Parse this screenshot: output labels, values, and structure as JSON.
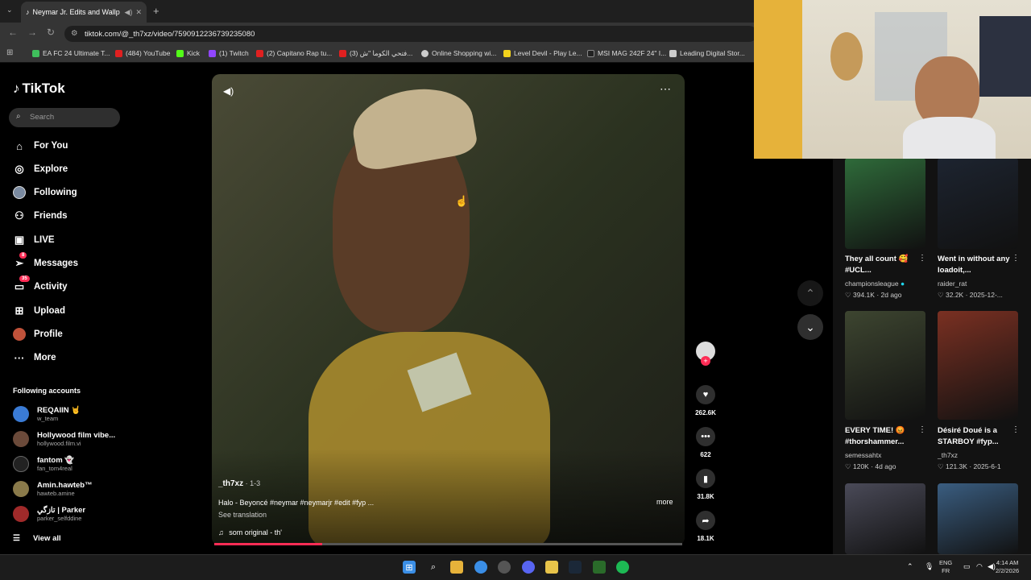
{
  "browser": {
    "tab_title": "Neymar Jr. Edits and Wallp",
    "url": "tiktok.com/@_th7xz/video/7590912236739235080",
    "bookmarks": [
      "EA FC 24 Ultimate T...",
      "(484) YouTube",
      "Kick",
      "(1) Twitch",
      "(2) Capitano Rap tu...",
      "(3) فتحي الكوما \"ش...",
      "Online Shopping wi...",
      "Level Devil - Play Le...",
      "MSI MAG 242F 24\" I...",
      "Leading Digital Stor..."
    ]
  },
  "sidebar": {
    "logo": "TikTok",
    "search_placeholder": "Search",
    "nav": [
      {
        "label": "For You",
        "icon": "home-icon"
      },
      {
        "label": "Explore",
        "icon": "compass-icon"
      },
      {
        "label": "Following",
        "icon": "following-icon"
      },
      {
        "label": "Friends",
        "icon": "friends-icon"
      },
      {
        "label": "LIVE",
        "icon": "live-icon"
      },
      {
        "label": "Messages",
        "icon": "messages-icon",
        "badge": "8"
      },
      {
        "label": "Activity",
        "icon": "activity-icon",
        "badge": "35"
      },
      {
        "label": "Upload",
        "icon": "upload-icon"
      },
      {
        "label": "Profile",
        "icon": "profile-icon"
      },
      {
        "label": "More",
        "icon": "more-icon"
      }
    ],
    "following_header": "Following accounts",
    "accounts": [
      {
        "name": "REQAIIN 🤘",
        "user": "w_team"
      },
      {
        "name": "Hollywood film vibe...",
        "user": "hollywood.film.vi"
      },
      {
        "name": "fantom 👻",
        "user": "fan_tom4real"
      },
      {
        "name": "Amin.hawteb™",
        "user": "hawteb.amine"
      },
      {
        "name": "تازگي | Parker",
        "user": "parker_selfddine"
      }
    ],
    "view_all": "View all"
  },
  "video": {
    "author": "_th7xz",
    "date": "· 1-3",
    "caption": "Halo - Beyoncé #neymar #neymarjr #edit #fyp ...",
    "more": "more",
    "see_translation": "See translation",
    "sound": "som original - th'",
    "progress": 0.23
  },
  "actions": {
    "likes": "262.6K",
    "comments": "622",
    "saves": "31.8K",
    "shares": "18.1K"
  },
  "right_panel": [
    {
      "caption": "They all count 🥰 #UCL...",
      "author": "championsleague",
      "views": "394.1K",
      "age": "2d ago",
      "color": "#2f6b3a"
    },
    {
      "caption": "Went in without any loadoit,...",
      "author": "raider_rat",
      "views": "32.2K",
      "age": "2025-12-...",
      "color": "#1d2430"
    },
    {
      "caption": "EVERY TIME! 😡 #thorshammer...",
      "author": "semessahtx",
      "views": "120K",
      "age": "4d ago",
      "color": "#3d4530"
    },
    {
      "caption": "Désiré Doué is a STARBOY #fyp...",
      "author": "_th7xz",
      "views": "121.3K",
      "age": "2025-6-1",
      "color": "#7a3022"
    },
    {
      "caption": "",
      "author": "",
      "views": "",
      "age": "",
      "color": "#4a4a58"
    },
    {
      "caption": "",
      "author": "",
      "views": "",
      "age": "",
      "color": "#3a5d80"
    }
  ],
  "taskbar": {
    "lang_top": "ENG",
    "lang_bottom": "FR",
    "time": "4:14 AM",
    "date": "2/2/2026"
  }
}
